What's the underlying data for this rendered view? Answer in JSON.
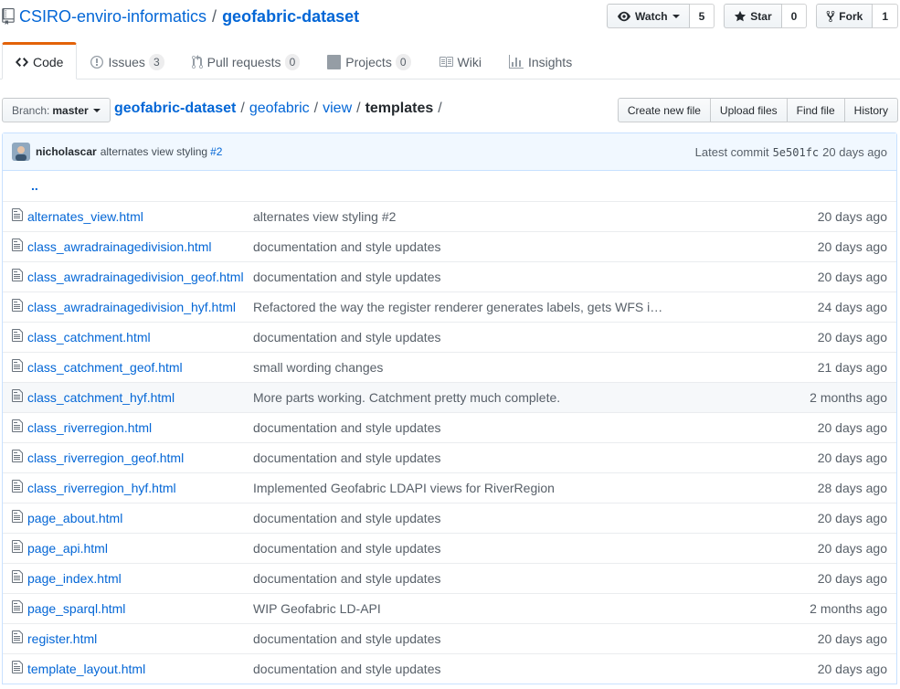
{
  "header": {
    "owner": "CSIRO-enviro-informatics",
    "separator": "/",
    "repo": "geofabric-dataset",
    "watch": {
      "label": "Watch",
      "count": "5"
    },
    "star": {
      "label": "Star",
      "count": "0"
    },
    "fork": {
      "label": "Fork",
      "count": "1"
    }
  },
  "nav": {
    "code": "Code",
    "issues": {
      "label": "Issues",
      "count": "3"
    },
    "pulls": {
      "label": "Pull requests",
      "count": "0"
    },
    "projects": {
      "label": "Projects",
      "count": "0"
    },
    "wiki": "Wiki",
    "insights": "Insights"
  },
  "file_nav": {
    "branch_prefix": "Branch:",
    "branch": "master",
    "breadcrumb": {
      "root": "geofabric-dataset",
      "parts": [
        "geofabric",
        "view"
      ],
      "final": "templates",
      "sep": "/"
    },
    "actions": [
      "Create new file",
      "Upload files",
      "Find file",
      "History"
    ]
  },
  "commit": {
    "author": "nicholascar",
    "message": "alternates view styling",
    "issue": "#2",
    "latest_label": "Latest commit",
    "sha": "5e501fc",
    "age": "20 days ago"
  },
  "up_tree": "..",
  "files": [
    {
      "name": "alternates_view.html",
      "message": "alternates view styling #2",
      "age": "20 days ago"
    },
    {
      "name": "class_awradrainagedivision.html",
      "message": "documentation and style updates",
      "age": "20 days ago"
    },
    {
      "name": "class_awradrainagedivision_geof.html",
      "message": "documentation and style updates",
      "age": "20 days ago"
    },
    {
      "name": "class_awradrainagedivision_hyf.html",
      "message": "Refactored the way the register renderer generates labels, gets WFS i…",
      "age": "24 days ago"
    },
    {
      "name": "class_catchment.html",
      "message": "documentation and style updates",
      "age": "20 days ago"
    },
    {
      "name": "class_catchment_geof.html",
      "message": "small wording changes",
      "age": "21 days ago"
    },
    {
      "name": "class_catchment_hyf.html",
      "message": "More parts working. Catchment pretty much complete.",
      "age": "2 months ago"
    },
    {
      "name": "class_riverregion.html",
      "message": "documentation and style updates",
      "age": "20 days ago"
    },
    {
      "name": "class_riverregion_geof.html",
      "message": "documentation and style updates",
      "age": "20 days ago"
    },
    {
      "name": "class_riverregion_hyf.html",
      "message": "Implemented Geofabric LDAPI views for RiverRegion",
      "age": "28 days ago"
    },
    {
      "name": "page_about.html",
      "message": "documentation and style updates",
      "age": "20 days ago"
    },
    {
      "name": "page_api.html",
      "message": "documentation and style updates",
      "age": "20 days ago"
    },
    {
      "name": "page_index.html",
      "message": "documentation and style updates",
      "age": "20 days ago"
    },
    {
      "name": "page_sparql.html",
      "message": "WIP Geofabric LD-API",
      "age": "2 months ago"
    },
    {
      "name": "register.html",
      "message": "documentation and style updates",
      "age": "20 days ago"
    },
    {
      "name": "template_layout.html",
      "message": "documentation and style updates",
      "age": "20 days ago"
    }
  ]
}
